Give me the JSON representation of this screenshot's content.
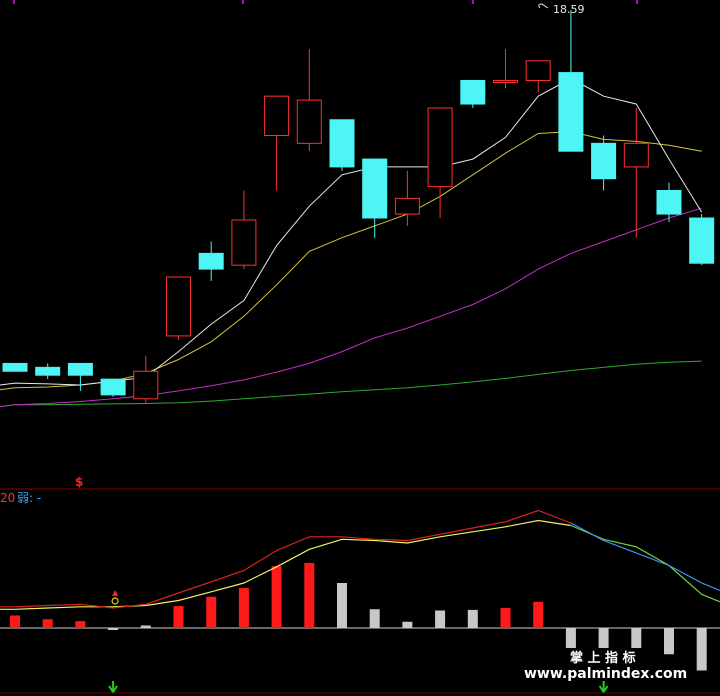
{
  "chart_data": [
    {
      "type": "candlestick",
      "annotation_high": "18.59",
      "signal_glyph": "$",
      "colors": {
        "up": "#ff3030",
        "down": "#4df5f5",
        "ma5": "#e8e8e8",
        "ma10": "#d4c23a",
        "ma20": "#c030c8",
        "ma60": "#2ea82e",
        "divider": "#8a0000",
        "tick": "#c000c0"
      },
      "candles": [
        {
          "o": 9.6,
          "c": 9.4,
          "h": 9.4,
          "l": 9.6
        },
        {
          "o": 9.5,
          "c": 9.3,
          "h": 9.6,
          "l": 9.2
        },
        {
          "o": 9.6,
          "c": 9.3,
          "h": 9.6,
          "l": 8.9
        },
        {
          "o": 9.2,
          "c": 8.8,
          "h": 9.2,
          "l": 8.75
        },
        {
          "o": 8.7,
          "c": 9.4,
          "h": 9.8,
          "l": 8.6
        },
        {
          "o": 10.3,
          "c": 11.8,
          "h": 11.8,
          "l": 10.2
        },
        {
          "o": 12.4,
          "c": 12.0,
          "h": 12.7,
          "l": 11.7
        },
        {
          "o": 12.1,
          "c": 13.25,
          "h": 14.0,
          "l": 12.0
        },
        {
          "o": 15.4,
          "c": 16.4,
          "h": 16.4,
          "l": 14.0
        },
        {
          "o": 15.2,
          "c": 16.3,
          "h": 17.6,
          "l": 15.0
        },
        {
          "o": 15.8,
          "c": 14.6,
          "h": 15.8,
          "l": 14.5
        },
        {
          "o": 14.8,
          "c": 13.3,
          "h": 14.6,
          "l": 12.8
        },
        {
          "o": 13.4,
          "c": 13.8,
          "h": 14.5,
          "l": 13.1
        },
        {
          "o": 14.1,
          "c": 16.1,
          "h": 16.1,
          "l": 13.3
        },
        {
          "o": 16.8,
          "c": 16.2,
          "h": 16.8,
          "l": 16.1
        },
        {
          "o": 16.8,
          "c": 16.8,
          "h": 17.6,
          "l": 16.6
        },
        {
          "o": 16.8,
          "c": 17.3,
          "h": 17.3,
          "l": 16.5
        },
        {
          "o": 17.0,
          "c": 15.0,
          "h": 18.59,
          "l": 15.0
        },
        {
          "o": 15.2,
          "c": 14.3,
          "h": 15.4,
          "l": 14.0
        },
        {
          "o": 14.6,
          "c": 15.2,
          "h": 16.1,
          "l": 12.8
        },
        {
          "o": 14.0,
          "c": 13.4,
          "h": 14.2,
          "l": 13.2
        },
        {
          "o": 13.3,
          "c": 12.15,
          "h": 13.4,
          "l": 12.1
        }
      ],
      "ma5": [
        9.1,
        9.08,
        9.05,
        9.15,
        9.25,
        9.9,
        10.6,
        11.2,
        12.6,
        13.6,
        14.4,
        14.6,
        14.6,
        14.6,
        14.8,
        15.35,
        16.4,
        16.85,
        16.4,
        16.2,
        14.8,
        13.45
      ],
      "ma10": [
        8.98,
        9.0,
        9.05,
        9.15,
        9.35,
        9.7,
        10.15,
        10.8,
        11.6,
        12.45,
        12.8,
        13.1,
        13.4,
        13.85,
        14.4,
        14.95,
        15.45,
        15.5,
        15.3,
        15.25,
        15.15,
        15.0
      ],
      "ma20": [
        8.55,
        8.58,
        8.63,
        8.7,
        8.78,
        8.9,
        9.03,
        9.18,
        9.38,
        9.6,
        9.9,
        10.25,
        10.5,
        10.8,
        11.1,
        11.5,
        12.0,
        12.4,
        12.7,
        13.0,
        13.3,
        13.55
      ],
      "ma60": [
        8.55,
        8.55,
        8.56,
        8.57,
        8.58,
        8.6,
        8.64,
        8.7,
        8.76,
        8.82,
        8.88,
        8.93,
        8.98,
        9.05,
        9.13,
        9.22,
        9.32,
        9.42,
        9.5,
        9.58,
        9.63,
        9.66
      ]
    },
    {
      "type": "bar+line",
      "label_prefix": "20",
      "label_text": "弱: -",
      "signal_value": 0,
      "signal_arrow_index": 3,
      "series": [
        {
          "values": [
            -0.85,
            -0.67,
            -0.5,
            -0.12,
            -0.25,
            -1.5,
            -2.08,
            -2.75,
            -4.5,
            -4.65,
            -3.5,
            -1.3,
            -0.4,
            -1.3,
            -1.25,
            -1.5,
            -1.95,
            null,
            null,
            null,
            null,
            null
          ]
        }
      ],
      "histogram": [
        1.0,
        0.7,
        0.55,
        -0.15,
        0.2,
        1.75,
        2.5,
        3.2,
        4.95,
        5.2,
        3.6,
        1.5,
        0.5,
        1.4,
        1.45,
        1.6,
        2.1,
        -1.6,
        -1.6,
        -1.6,
        -2.1,
        -3.4
      ],
      "line_a": [
        1.7,
        1.8,
        1.9,
        1.6,
        1.9,
        2.8,
        3.7,
        4.6,
        6.2,
        7.3,
        7.3,
        7.1,
        7.0,
        7.5,
        8.0,
        8.5,
        9.4,
        8.4,
        7.0,
        6.0,
        5.0,
        3.6
      ],
      "line_b": [
        1.5,
        1.6,
        1.7,
        1.7,
        1.8,
        2.2,
        2.9,
        3.6,
        4.9,
        6.3,
        7.1,
        7.0,
        6.8,
        7.3,
        7.7,
        8.1,
        8.6,
        8.2,
        7.1,
        6.5,
        5.0,
        2.7
      ],
      "arrow_bottom_indices": [
        3,
        18
      ]
    }
  ],
  "watermark": {
    "line1": "掌 上 指 标",
    "line2": "www.palmindex.com"
  }
}
